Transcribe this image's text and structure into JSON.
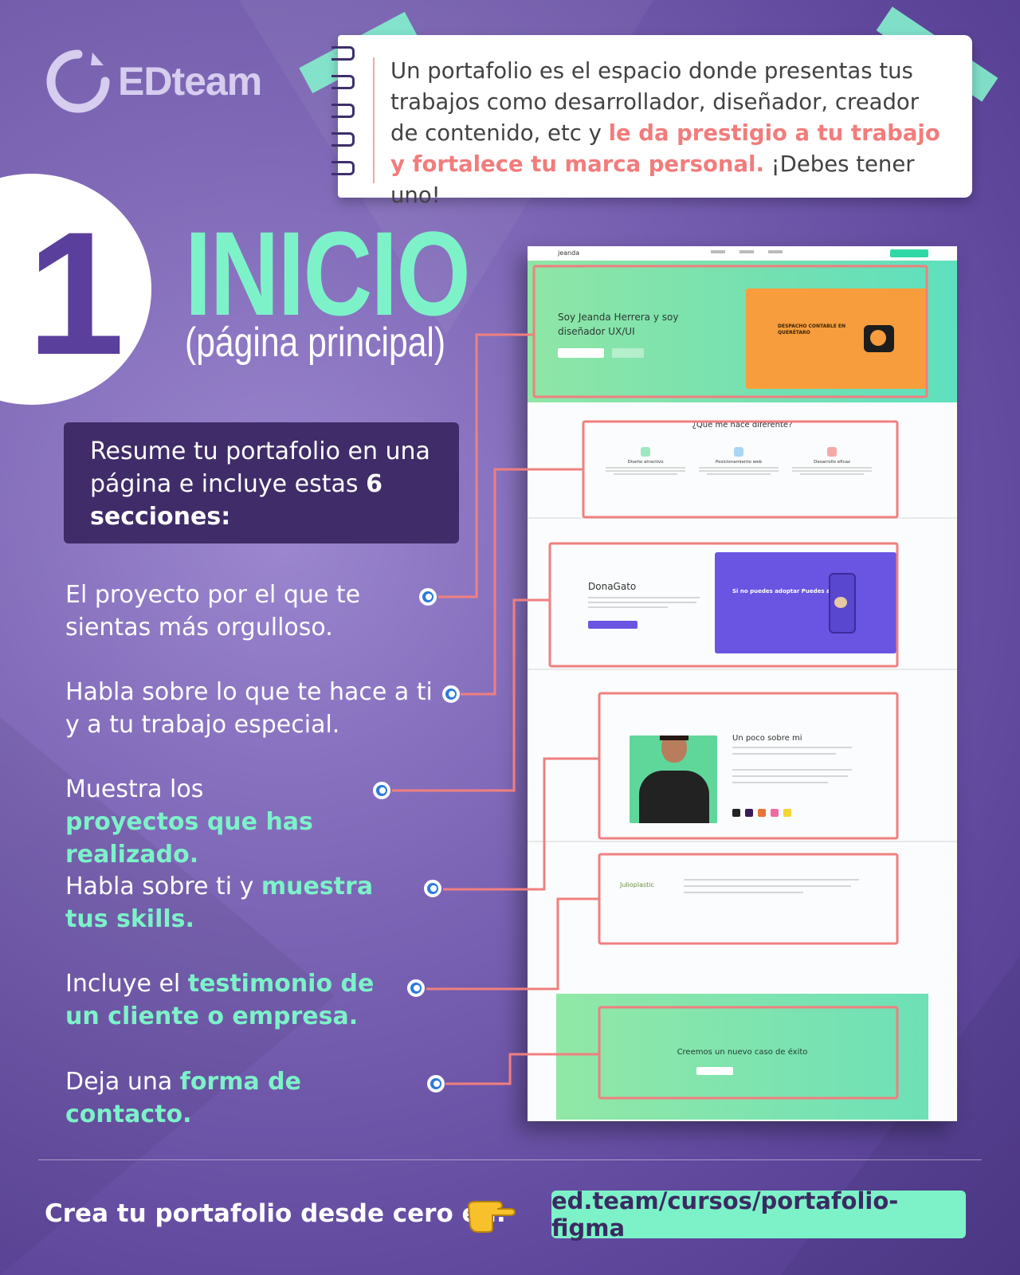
{
  "logo": {
    "text": "EDteam"
  },
  "note": {
    "part1": "Un portafolio es el espacio donde presentas tus trabajos como desarrollador, diseñador, creador de contenido, etc y ",
    "highlight": "le da prestigio a tu trabajo y fortalece tu marca personal.",
    "part2": " ¡Debes tener uno!"
  },
  "section": {
    "number": "1",
    "title": "INICIO",
    "subtitle": "(página principal)"
  },
  "summary": {
    "text": "Resume tu portafolio en una página e incluye estas ",
    "bold": "6 secciones:"
  },
  "items": [
    {
      "plain": "El proyecto por el que te sientas más orgulloso.",
      "highlight": ""
    },
    {
      "plain": "Habla sobre lo que te hace a ti y a tu trabajo especial.",
      "highlight": ""
    },
    {
      "plain": "Muestra los ",
      "highlight": "proyectos que has realizado."
    },
    {
      "plain": "Habla sobre ti y ",
      "highlight": "muestra tus skills."
    },
    {
      "plain": "Incluye el ",
      "highlight": "testimonio de un cliente o empresa."
    },
    {
      "plain": "Deja una ",
      "highlight": "forma de contacto."
    }
  ],
  "mockup": {
    "brand": "jeanda",
    "hero_text": "Soy Jeanda Herrera y soy diseñador UX/UI",
    "hero_card_title": "DESPACHO CONTABLE EN QUERÉTARO",
    "features_heading": "¿Qué me hace diferente?",
    "features": [
      "Diseño atractivo",
      "Posicionamiento web",
      "Desarrollo eficaz"
    ],
    "project_title": "DonaGato",
    "project_card_title": "Si no puedes adoptar Puedes ayudar",
    "about_title": "Un poco sobre mi",
    "testimonial_logo": "Julioplastic",
    "cta_title": "Creemos un nuevo caso de éxito"
  },
  "footer": {
    "text": "Crea tu portafolio desde cero en:",
    "url": "ed.team/cursos/portafolio-figma"
  },
  "colors": {
    "accent": "#7df2c9",
    "highlight_pink": "#f27c7c",
    "connector": "#f07f7f",
    "dark_purple": "#3f2c68"
  }
}
